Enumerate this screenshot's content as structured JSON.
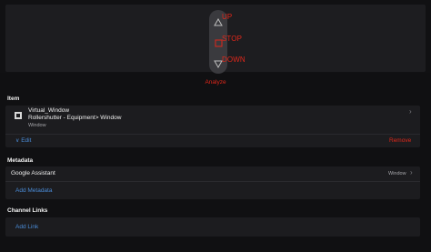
{
  "rollershutter": {
    "up_label": "UP",
    "stop_label": "STOP",
    "down_label": "DOWN"
  },
  "analyze_label": "Analyze",
  "item_section": {
    "title": "Item",
    "name": "Virtual_Window",
    "path": "Rollershutter - Equipment> Window",
    "type": "Window",
    "edit_label": "Edit",
    "remove_label": "Remove"
  },
  "metadata_section": {
    "title": "Metadata",
    "entry_label": "Google Assistant",
    "entry_value": "Window",
    "add_label": "Add Metadata"
  },
  "links_section": {
    "title": "Channel Links",
    "add_label": "Add Link"
  },
  "colors": {
    "accent_red": "#e0271a",
    "link_blue": "#4a8bd6",
    "background": "#101012",
    "card": "#1c1c1f"
  }
}
